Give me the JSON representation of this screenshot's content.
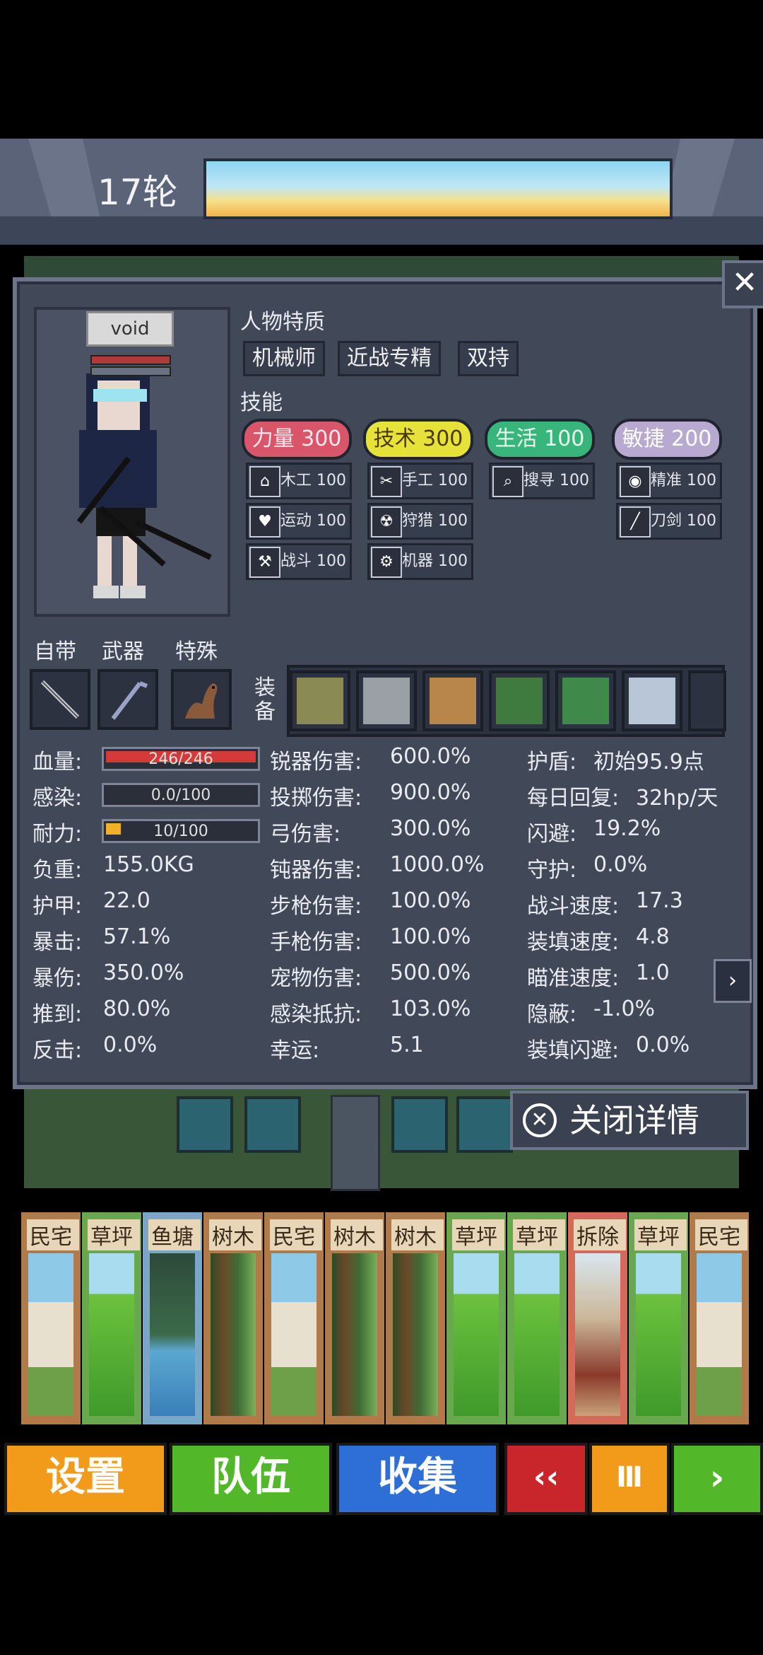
{
  "header": {
    "round_label": "17轮"
  },
  "panel": {
    "close_icon": "close-icon",
    "character": {
      "name": "void"
    },
    "traits_title": "人物特质",
    "traits": [
      "机械师",
      "近战专精",
      "双持"
    ],
    "skills_title": "技能",
    "skill_groups": [
      {
        "label": "力量 300",
        "color": "#d9566a",
        "text_color": "#ffe9ef",
        "subs": [
          {
            "icon": "house-icon",
            "glyph": "⌂",
            "label": "木工 100"
          },
          {
            "icon": "heart-icon",
            "glyph": "♥",
            "label": "运动 100"
          },
          {
            "icon": "hammer-icon",
            "glyph": "⚒",
            "label": "战斗 100"
          }
        ]
      },
      {
        "label": "技术 300",
        "color": "#e6e23a",
        "text_color": "#4a3a00",
        "subs": [
          {
            "icon": "scissors-icon",
            "glyph": "✂",
            "label": "手工 100"
          },
          {
            "icon": "radiation-icon",
            "glyph": "☢",
            "label": "狩猎 100"
          },
          {
            "icon": "gear-icon",
            "glyph": "⚙",
            "label": "机器 100"
          }
        ]
      },
      {
        "label": "生活 100",
        "color": "#38b57a",
        "text_color": "#e8fff2",
        "subs": [
          {
            "icon": "magnifier-icon",
            "glyph": "⌕",
            "label": "搜寻 100"
          }
        ]
      },
      {
        "label": "敏捷 200",
        "color": "#b7a9cf",
        "text_color": "#ffffff",
        "subs": [
          {
            "icon": "eye-icon",
            "glyph": "◉",
            "label": "精准 100"
          },
          {
            "icon": "blade-icon",
            "glyph": "╱",
            "label": "刀剑 100"
          }
        ]
      }
    ],
    "equipment": {
      "cat_builtin": "自带",
      "cat_weapon": "武器",
      "cat_special": "特殊",
      "equip_label": "装备",
      "builtin_icon": "knife-icon",
      "weapon_icon": "crowbar-icon",
      "special_icon": "ferret-pet-icon",
      "equip_icons": [
        "jacket-icon",
        "cap-icon",
        "bow-icon",
        "books-icon",
        "first-aid-book-icon",
        "scissors-note-icon"
      ]
    },
    "stats_left": [
      {
        "label": "血量:",
        "bar": true,
        "value": "246/246",
        "fill": 1.0,
        "color": "#d33b3b"
      },
      {
        "label": "感染:",
        "bar": true,
        "value": "0.0/100",
        "fill": 0.0,
        "color": "#8a8a8a"
      },
      {
        "label": "耐力:",
        "bar": true,
        "value": "10/100",
        "fill": 0.1,
        "color": "#f0b02a"
      },
      {
        "label": "负重:",
        "value": "155.0KG"
      },
      {
        "label": "护甲:",
        "value": "22.0"
      },
      {
        "label": "暴击:",
        "value": "57.1%"
      },
      {
        "label": "暴伤:",
        "value": "350.0%"
      },
      {
        "label": "推到:",
        "value": "80.0%"
      },
      {
        "label": "反击:",
        "value": "0.0%"
      }
    ],
    "stats_mid": [
      {
        "label": "锐器伤害:",
        "value": "600.0%"
      },
      {
        "label": "投掷伤害:",
        "value": "900.0%"
      },
      {
        "label": "弓伤害:",
        "value": "300.0%"
      },
      {
        "label": "钝器伤害:",
        "value": "1000.0%"
      },
      {
        "label": "步枪伤害:",
        "value": "100.0%"
      },
      {
        "label": "手枪伤害:",
        "value": "100.0%"
      },
      {
        "label": "宠物伤害:",
        "value": "500.0%"
      },
      {
        "label": "感染抵抗:",
        "value": "103.0%"
      },
      {
        "label": "幸运:",
        "value": "5.1"
      }
    ],
    "stats_right": [
      {
        "label": "护盾:",
        "value": "初始95.9点"
      },
      {
        "label": "每日回复:",
        "value": "32hp/天"
      },
      {
        "label": "闪避:",
        "value": "19.2%"
      },
      {
        "label": "守护:",
        "value": "0.0%"
      },
      {
        "label": "战斗速度:",
        "value": "17.3"
      },
      {
        "label": "装填速度:",
        "value": "4.8"
      },
      {
        "label": "瞄准速度:",
        "value": "1.0"
      },
      {
        "label": "隐蔽:",
        "value": "-1.0%"
      },
      {
        "label": "装填闪避:",
        "value": "0.0%"
      }
    ],
    "next_page_icon": "chevron-right-icon",
    "close_detail_label": "关闭详情"
  },
  "cards": [
    {
      "label": "民宅",
      "border": "#b07a4a",
      "bg": "#d6c7a7",
      "art": "house"
    },
    {
      "label": "草坪",
      "border": "#6aa84f",
      "bg": "#7cc44e",
      "art": "grass"
    },
    {
      "label": "鱼塘",
      "border": "#7aa7c8",
      "bg": "#4e8fb0",
      "art": "pond"
    },
    {
      "label": "树木",
      "border": "#b07a4a",
      "bg": "#3f6b34",
      "art": "tree"
    },
    {
      "label": "民宅",
      "border": "#b07a4a",
      "bg": "#d6c7a7",
      "art": "house"
    },
    {
      "label": "树木",
      "border": "#b07a4a",
      "bg": "#3f6b34",
      "art": "tree"
    },
    {
      "label": "树木",
      "border": "#b07a4a",
      "bg": "#3f6b34",
      "art": "tree"
    },
    {
      "label": "草坪",
      "border": "#6aa84f",
      "bg": "#7cc44e",
      "art": "grass"
    },
    {
      "label": "草坪",
      "border": "#6aa84f",
      "bg": "#7cc44e",
      "art": "grass"
    },
    {
      "label": "拆除",
      "border": "#d46a5a",
      "bg": "#c9b08f",
      "art": "ruin"
    },
    {
      "label": "草坪",
      "border": "#6aa84f",
      "bg": "#7cc44e",
      "art": "grass"
    },
    {
      "label": "民宅",
      "border": "#b07a4a",
      "bg": "#d6c7a7",
      "art": "house"
    }
  ],
  "bottom_bar": {
    "settings": "设置",
    "team": "队伍",
    "collect": "收集",
    "rewind": "‹‹",
    "pause": "Ⅲ",
    "play": "›"
  }
}
